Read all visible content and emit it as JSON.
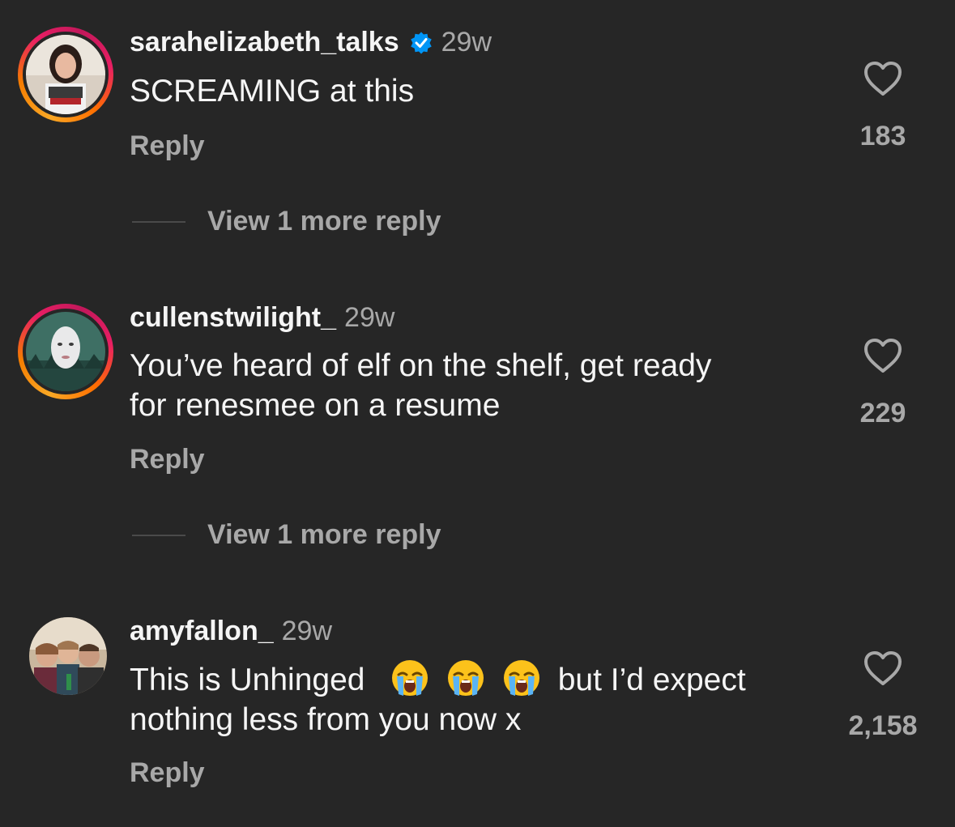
{
  "comments": [
    {
      "username": "sarahelizabeth_talks",
      "verified": true,
      "time": "29w",
      "text": "SCREAMING at this",
      "reply_label": "Reply",
      "likes": "183",
      "view_more": "View 1 more reply",
      "avatar_ring": true
    },
    {
      "username": "cullenstwilight_",
      "verified": false,
      "time": "29w",
      "text_line1": "You’ve heard of elf on the shelf, get ready",
      "text_line2": "for renesmee on a resume",
      "reply_label": "Reply",
      "likes": "229",
      "view_more": "View 1 more reply",
      "avatar_ring": true
    },
    {
      "username": "amyfallon_",
      "verified": false,
      "time": "29w",
      "text_before_emoji": "This is Unhinged",
      "emoji": [
        "loudly-crying-face",
        "loudly-crying-face",
        "loudly-crying-face"
      ],
      "text_after_emoji": "but I’d expect",
      "text_line2": "nothing less from you now x",
      "reply_label": "Reply",
      "likes": "2,158",
      "avatar_ring": false
    }
  ],
  "colors": {
    "background": "#262626",
    "primary_text": "#f5f5f5",
    "secondary_text": "#a8a8a8",
    "verified_blue": "#0095f6"
  }
}
